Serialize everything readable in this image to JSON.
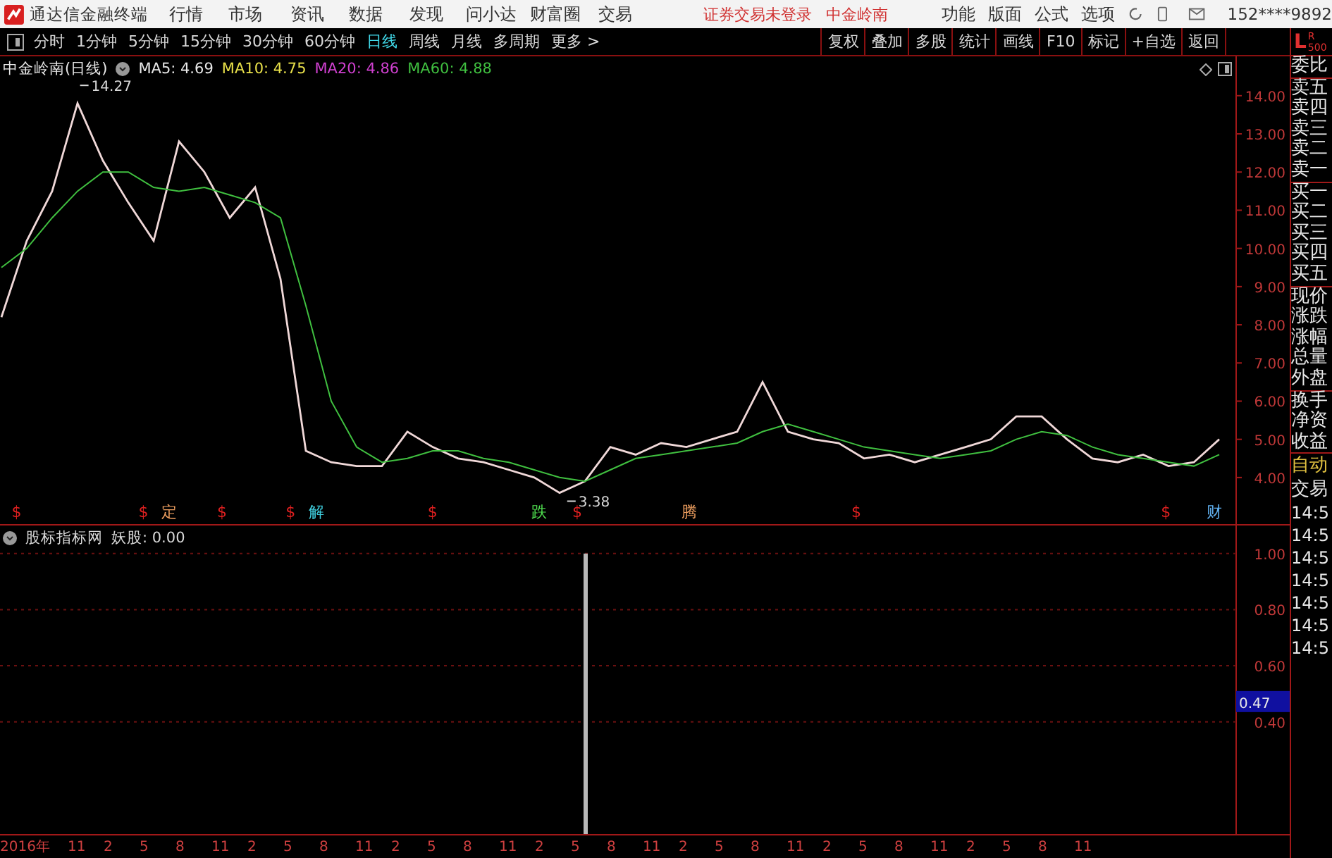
{
  "title_bar": {
    "app_name": "通达信金融终端",
    "menu": [
      "行情",
      "市场",
      "资讯",
      "数据",
      "发现",
      "问小达",
      "财富圈",
      "交易"
    ],
    "status": [
      "证券交易未登录",
      "中金岭南"
    ],
    "tools": [
      "功能",
      "版面",
      "公式",
      "选项"
    ],
    "account": "152****9892"
  },
  "toolbar": {
    "periods": [
      {
        "label": "分时",
        "selected": false
      },
      {
        "label": "1分钟",
        "selected": false
      },
      {
        "label": "5分钟",
        "selected": false
      },
      {
        "label": "15分钟",
        "selected": false
      },
      {
        "label": "30分钟",
        "selected": false
      },
      {
        "label": "60分钟",
        "selected": false
      },
      {
        "label": "日线",
        "selected": true
      },
      {
        "label": "周线",
        "selected": false
      },
      {
        "label": "月线",
        "selected": false
      },
      {
        "label": "多周期",
        "selected": false
      },
      {
        "label": "更多 >",
        "selected": false
      }
    ],
    "actions": [
      "复权",
      "叠加",
      "多股",
      "统计",
      "画线",
      "F10",
      "标记",
      "+自选",
      "返回"
    ]
  },
  "main_chart": {
    "stock": "中金岭南(日线)",
    "averages": [
      {
        "label": "MA5: 4.69",
        "color": "#e8e8e8"
      },
      {
        "label": "MA10: 4.75",
        "color": "#e8e04a"
      },
      {
        "label": "MA20: 4.86",
        "color": "#d040d0"
      },
      {
        "label": "MA60: 4.88",
        "color": "#40c040"
      }
    ],
    "chart_data": {
      "type": "line",
      "ylim": [
        2.78,
        15.03
      ],
      "yticks": [
        {
          "value": 4,
          "label": "4.00"
        },
        {
          "value": 5,
          "label": "5.00"
        },
        {
          "value": 6,
          "label": "6.00"
        },
        {
          "value": 7,
          "label": "7.00"
        },
        {
          "value": 8,
          "label": "8.00"
        },
        {
          "value": 9,
          "label": "9.00"
        },
        {
          "value": 10,
          "label": "10.00"
        },
        {
          "value": 11,
          "label": "11.00"
        },
        {
          "value": 12,
          "label": "12.00"
        },
        {
          "value": 13,
          "label": "13.00"
        },
        {
          "value": 14,
          "label": "14.00"
        }
      ],
      "series": [
        {
          "color": "#f0d8d8",
          "values": [
            8.2,
            10.2,
            11.5,
            13.8,
            12.3,
            11.2,
            10.2,
            12.8,
            12.0,
            10.8,
            11.6,
            9.2,
            4.7,
            4.4,
            4.3,
            4.3,
            5.2,
            4.8,
            4.5,
            4.4,
            4.2,
            4.0,
            3.6,
            3.9,
            4.8,
            4.6,
            4.9,
            4.8,
            5.0,
            5.2,
            6.5,
            5.2,
            5.0,
            4.9,
            4.5,
            4.6,
            4.4,
            4.6,
            4.8,
            5.0,
            5.6,
            5.6,
            5.0,
            4.5,
            4.4,
            4.6,
            4.3,
            4.4,
            5.0
          ]
        },
        {
          "color": "#40c040",
          "values": [
            9.5,
            10,
            10.8,
            11.5,
            12,
            12,
            11.6,
            11.5,
            11.6,
            11.4,
            11.2,
            10.8,
            8.5,
            6,
            4.8,
            4.4,
            4.5,
            4.7,
            4.7,
            4.5,
            4.4,
            4.2,
            4.0,
            3.9,
            4.2,
            4.5,
            4.6,
            4.7,
            4.8,
            4.9,
            5.2,
            5.4,
            5.2,
            5.0,
            4.8,
            4.7,
            4.6,
            4.5,
            4.6,
            4.7,
            5.0,
            5.2,
            5.1,
            4.8,
            4.6,
            4.5,
            4.4,
            4.3,
            4.6
          ]
        }
      ],
      "annotations": [
        "14.27",
        "3.38"
      ]
    },
    "events": [
      {
        "text": "$",
        "color": "#e02020"
      },
      {
        "text": "$",
        "color": "#e02020"
      },
      {
        "text": "定",
        "color": "#f0a060"
      },
      {
        "text": "$",
        "color": "#e02020"
      },
      {
        "text": "$",
        "color": "#e02020"
      },
      {
        "text": "解",
        "color": "#40d0e0"
      },
      {
        "text": "$",
        "color": "#e02020"
      },
      {
        "text": "跌",
        "color": "#50e050"
      },
      {
        "text": "$",
        "color": "#e02020"
      },
      {
        "text": "腾",
        "color": "#f0a060"
      },
      {
        "text": "$",
        "color": "#e02020"
      },
      {
        "text": "$",
        "color": "#e02020"
      },
      {
        "text": "财",
        "color": "#60b0f0"
      }
    ]
  },
  "indicator": {
    "name": "股标指标网",
    "reading": "妖股: 0.00",
    "cursor_value": "0.47",
    "chart_data": {
      "type": "bar",
      "grid": true,
      "ylim": [
        0,
        1.1
      ],
      "yticks": [
        {
          "value": 0.4,
          "label": "0.40"
        },
        {
          "value": 0.6,
          "label": "0.60"
        },
        {
          "value": 0.8,
          "label": "0.80"
        },
        {
          "value": 1,
          "label": "1.00"
        }
      ],
      "values": [
        0,
        0,
        0,
        0,
        0,
        0,
        0,
        0,
        0,
        0,
        0,
        0,
        0,
        0,
        0,
        0,
        0,
        0,
        0,
        0,
        0,
        0,
        0,
        1,
        0,
        0,
        0,
        0,
        0,
        0,
        0,
        0,
        0,
        0,
        0,
        0,
        0,
        0,
        0,
        0,
        0,
        0,
        0,
        0,
        0,
        0,
        0,
        0,
        0
      ]
    }
  },
  "x_axis": [
    "2016年",
    "11",
    "2",
    "5",
    "8",
    "11",
    "2",
    "5",
    "8",
    "11",
    "2",
    "5",
    "8",
    "11",
    "2",
    "5",
    "8",
    "11",
    "2",
    "5",
    "8",
    "11",
    "2",
    "5",
    "8",
    "11",
    "2",
    "5",
    "8",
    "11"
  ],
  "quote_panel": {
    "header": "L",
    "subheader": [
      "R",
      "500"
    ],
    "groups": [
      [
        "委比"
      ],
      [
        "卖五",
        "卖四",
        "卖三",
        "卖二",
        "卖一"
      ],
      [
        "买一",
        "买二",
        "买三",
        "买四",
        "买五"
      ],
      [
        "现价",
        "涨跌",
        "涨幅",
        "总量",
        "外盘"
      ],
      [
        "换手",
        "净资",
        "收益"
      ]
    ]
  },
  "trade_panel": {
    "title": "自动",
    "subtitle": "交易",
    "times": [
      "14:5",
      "14:5",
      "14:5",
      "14:5",
      "14:5",
      "14:5",
      "14:5"
    ]
  }
}
